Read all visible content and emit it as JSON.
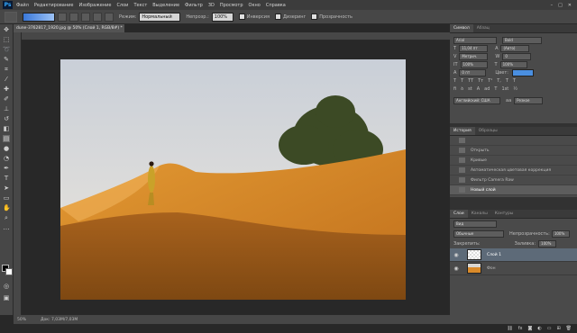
{
  "menu": {
    "logo": "Ps",
    "items": [
      "Файл",
      "Редактирование",
      "Изображение",
      "Слои",
      "Текст",
      "Выделение",
      "Фильтр",
      "3D",
      "Просмотр",
      "Окно",
      "Справка"
    ],
    "window_controls": [
      "–",
      "□",
      "✕"
    ]
  },
  "options": {
    "mode_label": "Режим:",
    "mode_value": "Нормальный",
    "opacity_label": "Непрозр.:",
    "opacity_value": "100%",
    "inverse_label": "Инверсия",
    "dither_label": "Дизеринг",
    "transparency_label": "Прозрачность"
  },
  "document": {
    "tab_title": "dune-3762817_1920.jpg @ 50% (Слой 1, RGB/8#) *",
    "zoom": "50%",
    "doc_info": "Док: 7,03M/7,03M"
  },
  "character_panel": {
    "tabs": [
      "Символ",
      "Абзац"
    ],
    "font_family": "Arial",
    "font_style": "Bold",
    "size": "11,04 пт",
    "leading": "(Авто)",
    "kerning": "Метрич.",
    "tracking": "0",
    "scale_v": "100%",
    "scale_h": "100%",
    "baseline": "0 пт",
    "color_label": "Цвет:",
    "color_value": "#4a8fe0",
    "style_buttons": [
      "T",
      "T",
      "TT",
      "Tт",
      "T¹",
      "T,",
      "T",
      "T"
    ],
    "ot_buttons": [
      "fi",
      "ꝺ",
      "st",
      "A",
      "ad",
      "T",
      "1st",
      "½"
    ],
    "language": "Английский: США",
    "antialias_icon": "aa",
    "antialias": "Резкое"
  },
  "history_panel": {
    "tabs": [
      "История",
      "Образцы"
    ],
    "items": [
      "",
      "Открыть",
      "Кривые",
      "Автоматическая цветовая коррекция",
      "Фильтр Camera Raw",
      "Новый слой"
    ],
    "selected_index": 5
  },
  "layers_panel": {
    "tabs": [
      "Слои",
      "Каналы",
      "Контуры"
    ],
    "kind_filter": "Вид",
    "blend_mode": "Обычные",
    "opacity_label": "Непрозрачность:",
    "opacity_value": "100%",
    "lock_label": "Закрепить:",
    "fill_label": "Заливка:",
    "fill_value": "100%",
    "layers": [
      {
        "name": "Слой 1",
        "selected": true,
        "visible": true
      },
      {
        "name": "Фон",
        "selected": false,
        "visible": true
      }
    ]
  },
  "colors": {
    "accent": "#31a8ff",
    "gradient_start": "#3a78d9",
    "gradient_end": "#9cc2f5"
  }
}
